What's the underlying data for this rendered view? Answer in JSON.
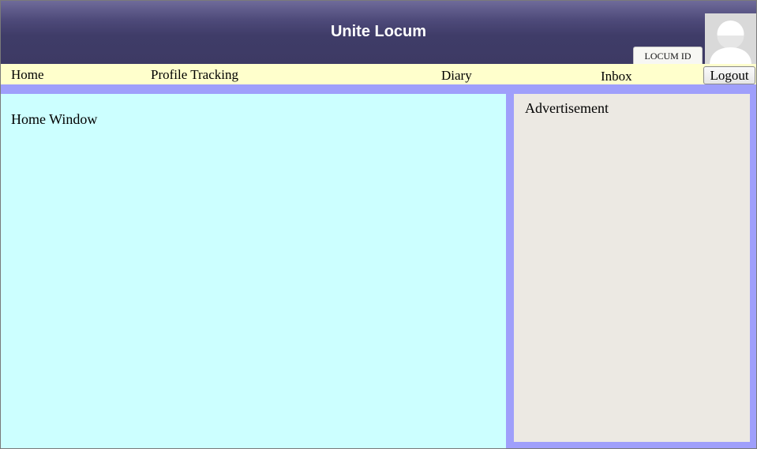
{
  "header": {
    "title": "Unite Locum",
    "locum_id_label": "LOCUM ID"
  },
  "nav": {
    "items": [
      {
        "label": "Home"
      },
      {
        "label": "Profile Tracking"
      },
      {
        "label": "Diary"
      },
      {
        "label": "Inbox"
      }
    ],
    "logout_label": "Logout"
  },
  "main": {
    "home_window_label": "Home Window"
  },
  "sidebar": {
    "advertisement_label": "Advertisement"
  },
  "colors": {
    "header_bg": "#3f3c68",
    "navbar_bg": "#ffffcc",
    "content_border": "#9f9ffb",
    "home_window_bg": "#ccffff",
    "ad_panel_bg": "#ece9e3"
  },
  "icons": {
    "avatar": "user-avatar-placeholder-icon"
  }
}
